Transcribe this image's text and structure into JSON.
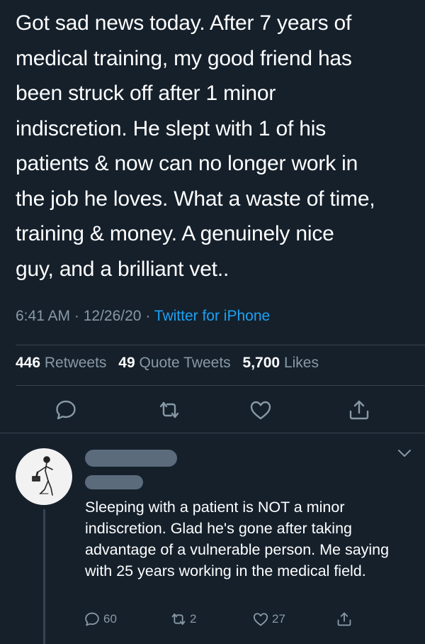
{
  "tweet": {
    "text": "Got sad news today. After 7 years of\nmedical training, my good friend has\nbeen struck off after 1 minor\nindiscretion. He slept with 1 of his\npatients & now can no longer work in\nthe job he loves. What a waste of time,\ntraining & money. A genuinely nice\nguy, and a brilliant vet..",
    "time": "6:41 AM",
    "separator": " · ",
    "date": "12/26/20",
    "source": "Twitter for iPhone",
    "stats": {
      "retweets_count": "446",
      "retweets_label": "Retweets",
      "quotes_count": "49",
      "quotes_label": "Quote Tweets",
      "likes_count": "5,700",
      "likes_label": "Likes"
    }
  },
  "reply": {
    "text": "Sleeping with a patient is NOT a minor indiscretion. Glad he's gone after taking advantage of a vulnerable person. Me saying with 25 years working in the medical field.",
    "reply_count": "60",
    "retweet_count": "2",
    "like_count": "27"
  },
  "icons": {
    "reply": "reply-icon",
    "retweet": "retweet-icon",
    "like": "heart-icon",
    "share": "share-icon",
    "more": "chevron-down-icon"
  },
  "colors": {
    "background": "#15202b",
    "secondary_text": "#8899a6",
    "link": "#1da1f2",
    "divider": "#38444d"
  }
}
